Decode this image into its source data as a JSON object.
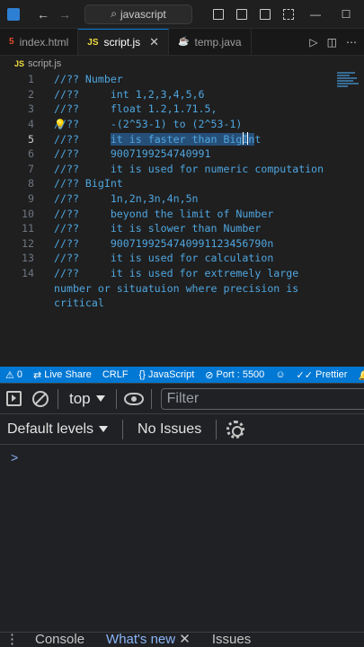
{
  "titlebar": {
    "search_text": "javascript"
  },
  "tabs": [
    {
      "label": "index.html",
      "icon": "html-file-icon"
    },
    {
      "label": "script.js",
      "icon": "js-file-icon",
      "active": true
    },
    {
      "label": "temp.java",
      "icon": "java-file-icon"
    }
  ],
  "breadcrumb": {
    "icon": "JS",
    "file": "script.js"
  },
  "editor": {
    "lines": [
      {
        "num": "1",
        "text": "//?? Number"
      },
      {
        "num": "2",
        "text": "//??     int 1,2,3,4,5,6"
      },
      {
        "num": "3",
        "text": "//??     float 1.2,1.71.5,"
      },
      {
        "num": "4",
        "text": "//??     -(2^53-1) to (2^53-1)"
      },
      {
        "num": "5",
        "prefix": "//??     ",
        "selected": "it is faster than BigIn",
        "suffix": "t"
      },
      {
        "num": "6",
        "text": "//??     9007199254740991"
      },
      {
        "num": "7",
        "text": "//??     it is used for numeric computation"
      },
      {
        "num": "8",
        "text": "//?? BigInt"
      },
      {
        "num": "9",
        "text": "//??     1n,2n,3n,4n,5n"
      },
      {
        "num": "10",
        "text": "//??     beyond the limit of Number"
      },
      {
        "num": "11",
        "text": "//??     it is slower than Number"
      },
      {
        "num": "12",
        "text": "//??     9007199254740991123456790n"
      },
      {
        "num": "13",
        "text": "//??     it is used for calculation"
      },
      {
        "num": "14",
        "text": "//??     it is used for extremely large"
      },
      {
        "num": "",
        "text": "number or situatuion where precision is"
      },
      {
        "num": "",
        "text": "critical"
      }
    ]
  },
  "statusbar": {
    "remote": "0",
    "live_share": "Live Share",
    "eol": "CRLF",
    "language": "JavaScript",
    "port": "Port : 5500",
    "prettier": "Prettier"
  },
  "devtools": {
    "context": "top",
    "filter_placeholder": "Filter",
    "levels": "Default levels",
    "issues": "No Issues",
    "prompt": ">",
    "drawer_tabs": [
      "Console",
      "What's new",
      "Issues"
    ]
  },
  "colors": {
    "accent": "#0078d4",
    "code": "#4fa6e0",
    "selection": "#264f78"
  }
}
